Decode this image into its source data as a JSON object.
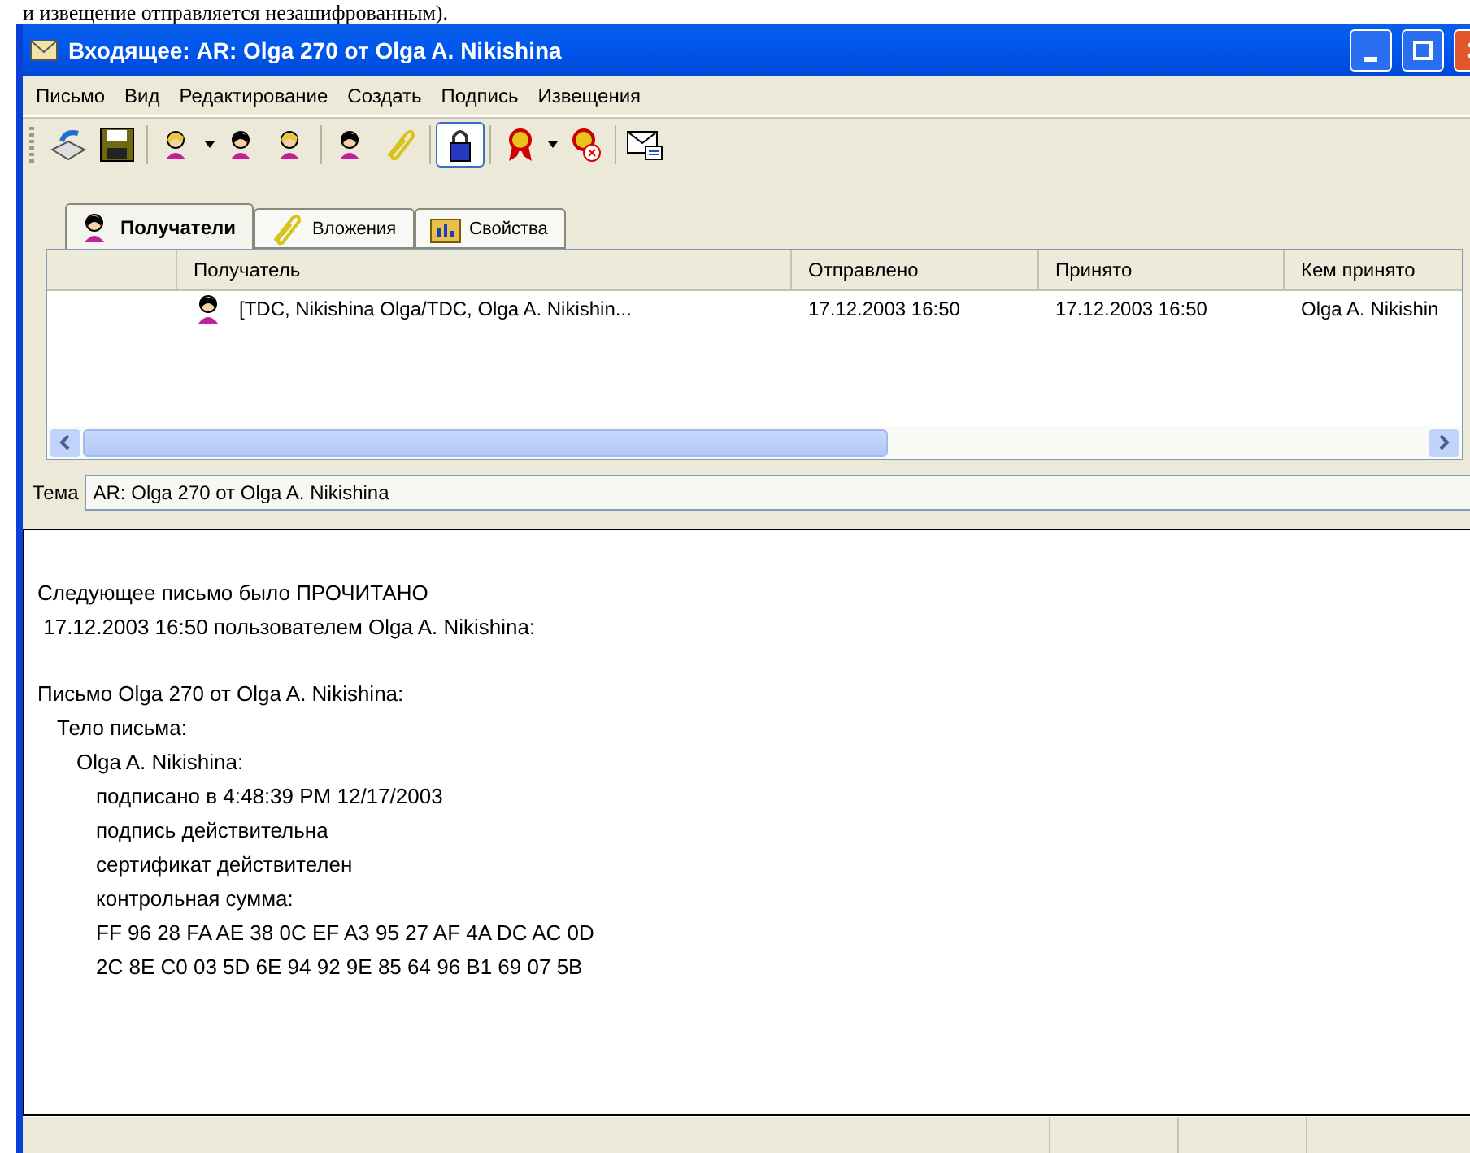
{
  "document_line": "и извещение отправляется незашифрованным).",
  "window": {
    "title": "Входящее: AR: Olga 270 от Olga A. Nikishina"
  },
  "menu": [
    "Письмо",
    "Вид",
    "Редактирование",
    "Создать",
    "Подпись",
    "Извещения"
  ],
  "toolbar": [
    [
      {
        "kind": "button",
        "pressed": false
      },
      {
        "kind": "button",
        "pressed": false
      }
    ],
    [
      {
        "kind": "button",
        "pressed": false
      },
      {
        "kind": "caret"
      },
      {
        "kind": "button",
        "pressed": false
      },
      {
        "kind": "button",
        "pressed": false
      }
    ],
    [
      {
        "kind": "button",
        "pressed": false
      },
      {
        "kind": "button",
        "pressed": false
      }
    ],
    [
      {
        "kind": "button",
        "pressed": true
      }
    ],
    [
      {
        "kind": "button",
        "pressed": false
      },
      {
        "kind": "caret"
      },
      {
        "kind": "button",
        "pressed": false
      }
    ],
    [
      {
        "kind": "button",
        "pressed": false
      }
    ]
  ],
  "tabs": [
    {
      "label": "Получатели",
      "selected": true
    },
    {
      "label": "Вложения",
      "selected": false
    },
    {
      "label": "Свойства",
      "selected": false
    }
  ],
  "table": {
    "columns": [
      "Получатель",
      "Отправлено",
      "Принято",
      "Кем принято"
    ],
    "rows": [
      [
        "[TDC, Nikishina Olga/TDC, Olga A. Nikishin...",
        "17.12.2003 16:50",
        "17.12.2003 16:50",
        "Olga A. Nikishin"
      ]
    ]
  },
  "subject": {
    "label": "Тема",
    "value": "AR: Olga 270 от Olga A. Nikishina"
  },
  "body": [
    {
      "text": "Следующее письмо было ПРОЧИТАНО"
    },
    {
      "text": " 17.12.2003 16:50 пользователем Olga A. Nikishina:"
    },
    {
      "text": "Письмо Olga 270 от Olga A. Nikishina:",
      "children": [
        {
          "text": "Тело письма:",
          "children": [
            {
              "text": "Olga A. Nikishina:",
              "children": [
                {
                  "text": "подписано в 4:48:39 PM 12/17/2003"
                },
                {
                  "text": "подпись действительна"
                },
                {
                  "text": "сертификат действителен"
                },
                {
                  "text": "контрольная сумма:"
                },
                {
                  "text": "FF 96 28 FA AE 38 0C EF A3 95 27 AF 4A DC AC 0D"
                },
                {
                  "text": "2C 8E C0 03 5D 6E 94 92 9E 85 64 96 B1 69 07 5B"
                }
              ]
            }
          ]
        }
      ]
    }
  ]
}
